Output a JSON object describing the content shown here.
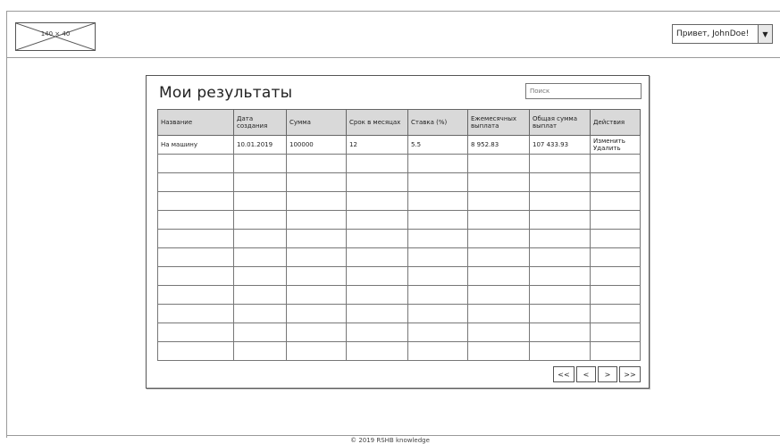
{
  "header": {
    "logo_placeholder": "140 × 40",
    "user_greeting": "Привет, JohnDoe!",
    "dropdown_icon": "caret-down-icon"
  },
  "main": {
    "title": "Мои результаты",
    "search_placeholder": "Поиск",
    "table": {
      "columns": [
        "Название",
        "Дата создания",
        "Сумма",
        "Срок в месяцах",
        "Ставка (%)",
        "Ежемесячных выплата",
        "Общая сумма выплат",
        "Действия"
      ],
      "rows": [
        {
          "name": "На машину",
          "date": "10.01.2019",
          "sum": "100000",
          "term": "12",
          "rate": "5.5",
          "monthly": "8 952.83",
          "total": "107 433.93",
          "action_edit": "Изменить",
          "action_delete": "Удалить"
        }
      ]
    },
    "pager": {
      "first": "<<",
      "prev": "<",
      "next": ">",
      "last": ">>"
    }
  },
  "footer": {
    "copyright": "© 2019 RSHB knowledge"
  }
}
